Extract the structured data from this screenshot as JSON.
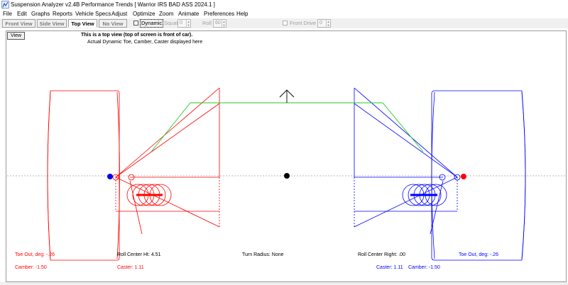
{
  "window": {
    "title": "Suspension Analyzer v2.4B    Performance Trends    [ Warrior IRS BAD ASS 2024.1 ]"
  },
  "menu": [
    "File",
    "Edit",
    "Graphs",
    "Reports",
    "Vehicle Specs",
    "Adjust",
    "Optimize",
    "Zoom",
    "Animate",
    "Preferences",
    "Help"
  ],
  "toolbar": {
    "tabs": [
      "Front View",
      "Side View",
      "Top View",
      "No View"
    ],
    "active_tab": "Top View",
    "dynamic_label": "Dynamic",
    "squat_label": "Squat",
    "squat_value": "0",
    "roll_label": "Roll",
    "roll_value": "60",
    "front_drive_label": "Front Drive",
    "front_drive_value": "0"
  },
  "view_button": "View",
  "header": {
    "line1": "This is a top view (top of screen is front of car).",
    "line2": "Actual Dynamic Toe, Camber, Caster displayed here"
  },
  "readouts": {
    "toe_left": "Toe Out, deg: -.26",
    "camber_left": "Camber: -1.50",
    "roll_center_ht": "Roll Center Ht: 4.51",
    "caster_left": "Caster: 1.11",
    "turn_radius": "Turn Radius: None",
    "roll_center_right": "Roll Center Right: .00",
    "caster_right": "Caster: 1.11",
    "camber_right": "Camber: -1.50",
    "toe_right": "Toe Out, deg: -.26"
  },
  "colors": {
    "left_side": "#ff0000",
    "right_side": "#0000ff",
    "tie_rod": "#22cc22",
    "center_marker": "#000000"
  }
}
